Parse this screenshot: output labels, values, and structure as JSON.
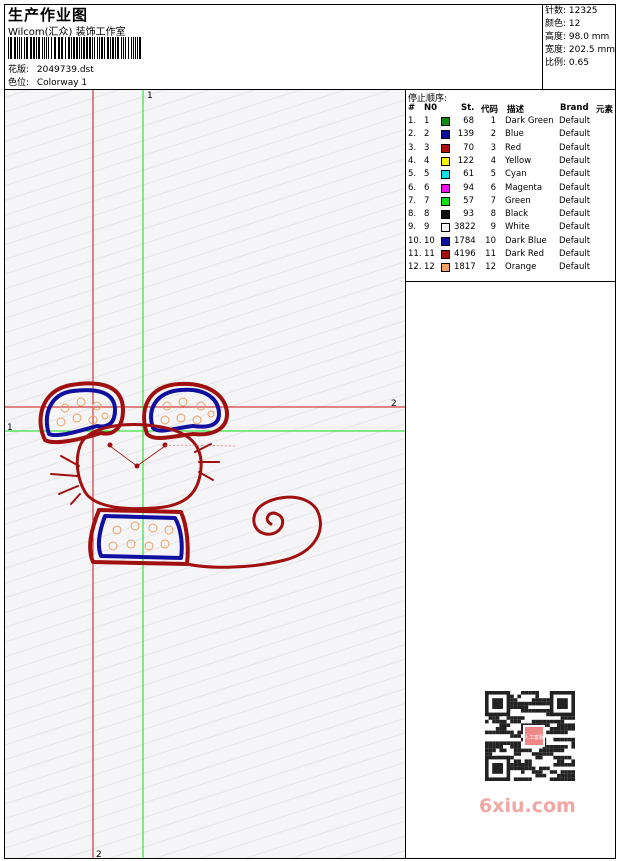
{
  "header": {
    "title": "生产作业图",
    "company": "Wilcom(汇众) 装饰工作室",
    "design_label": "花版:",
    "design_value": "2049739.dst",
    "colorway_label": "色位:",
    "colorway_value": "Colorway 1"
  },
  "stats": {
    "stitches": "针数: 12325",
    "colors": "颜色: 12",
    "height": "高度: 98.0 mm",
    "width": "宽度: 202.5 mm",
    "scale": "比例: 0.65"
  },
  "canvas": {
    "marker_1_top": "1",
    "marker_1_left": "1",
    "marker_2_right": "2",
    "marker_2_bottom": "2"
  },
  "stop_sequence": {
    "title": "停止顺序:",
    "headers": {
      "hash": "#",
      "no": "N0",
      "st": "St.",
      "code": "代码",
      "desc": "描述",
      "brand": "Brand",
      "element": "元素"
    },
    "rows": [
      {
        "idx": "1.",
        "no": "1",
        "color": "#118a11",
        "st": "68",
        "code": "1",
        "desc": "Dark Green",
        "brand": "Default"
      },
      {
        "idx": "2.",
        "no": "2",
        "color": "#0a0a9a",
        "st": "139",
        "code": "2",
        "desc": "Blue",
        "brand": "Default"
      },
      {
        "idx": "3.",
        "no": "3",
        "color": "#b01010",
        "st": "70",
        "code": "3",
        "desc": "Red",
        "brand": "Default"
      },
      {
        "idx": "4.",
        "no": "4",
        "color": "#f5f50a",
        "st": "122",
        "code": "4",
        "desc": "Yellow",
        "brand": "Default"
      },
      {
        "idx": "5.",
        "no": "5",
        "color": "#10e0e8",
        "st": "61",
        "code": "5",
        "desc": "Cyan",
        "brand": "Default"
      },
      {
        "idx": "6.",
        "no": "6",
        "color": "#ee10ee",
        "st": "94",
        "code": "6",
        "desc": "Magenta",
        "brand": "Default"
      },
      {
        "idx": "7.",
        "no": "7",
        "color": "#10e010",
        "st": "57",
        "code": "7",
        "desc": "Green",
        "brand": "Default"
      },
      {
        "idx": "8.",
        "no": "8",
        "color": "#101010",
        "st": "93",
        "code": "8",
        "desc": "Black",
        "brand": "Default"
      },
      {
        "idx": "9.",
        "no": "9",
        "color": "#f4f4f4",
        "st": "3822",
        "code": "9",
        "desc": "White",
        "brand": "Default"
      },
      {
        "idx": "10.",
        "no": "10",
        "color": "#1010a0",
        "st": "1784",
        "code": "10",
        "desc": "Dark Blue",
        "brand": "Default"
      },
      {
        "idx": "11.",
        "no": "11",
        "color": "#a01010",
        "st": "4196",
        "code": "11",
        "desc": "Dark Red",
        "brand": "Default"
      },
      {
        "idx": "12.",
        "no": "12",
        "color": "#f0a060",
        "st": "1817",
        "code": "12",
        "desc": "Orange",
        "brand": "Default"
      }
    ]
  },
  "watermark": {
    "text": "6xiu.com",
    "qr_badge": "人工客服"
  }
}
